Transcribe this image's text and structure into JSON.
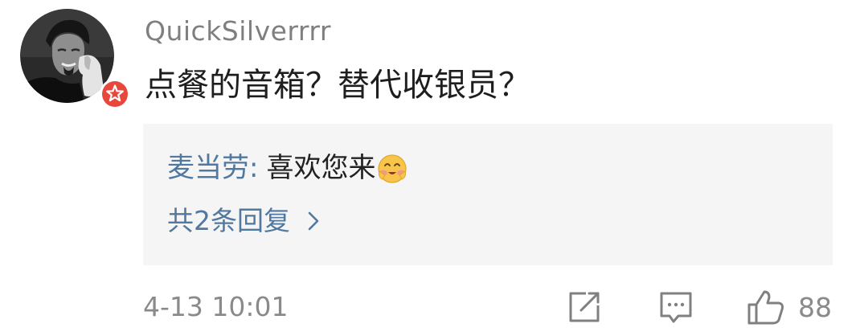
{
  "comment": {
    "username": "QuickSilverrrr",
    "text": "点餐的音箱？替代收银员？",
    "timestamp": "4-13 10:01",
    "like_count": "88",
    "avatar": {
      "icon": "user-avatar-photo",
      "badge_icon": "verified-star-badge-icon",
      "badge_color": "#e8483b"
    }
  },
  "reply_preview": {
    "author": "麦当劳",
    "separator": ":",
    "content": "喜欢您来",
    "emoji": "blushing-smile-emoji",
    "more_link": "共2条回复"
  },
  "actions": {
    "share_icon": "share-icon",
    "comment_icon": "comment-icon",
    "like_icon": "thumbs-up-icon"
  },
  "colors": {
    "username": "#7f7f7f",
    "link": "#51789f",
    "reply_background": "#f5f5f5",
    "meta_text": "#8a8a8a"
  }
}
